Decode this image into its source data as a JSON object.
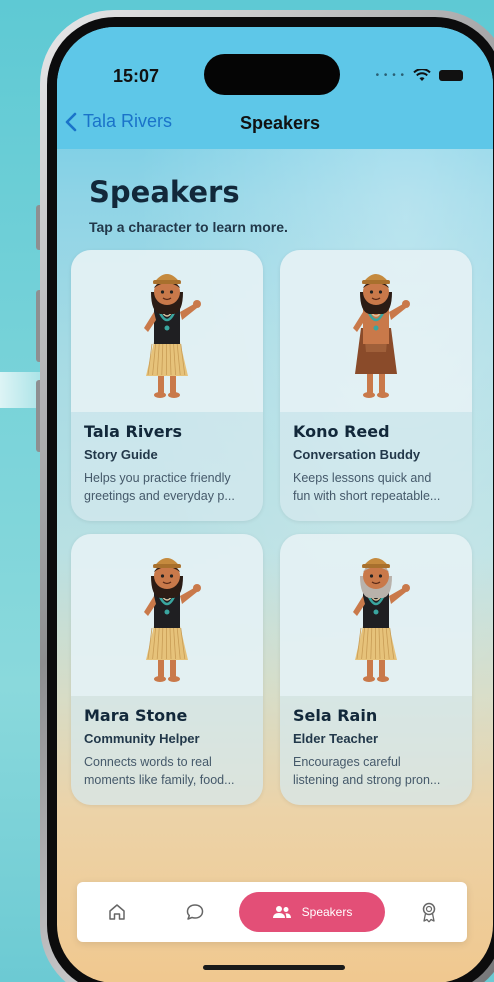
{
  "status": {
    "time": "15:07"
  },
  "nav": {
    "back_label": "Tala Rivers",
    "title": "Speakers"
  },
  "page": {
    "title": "Speakers",
    "subtitle": "Tap a character to learn more."
  },
  "speakers": [
    {
      "name": "Tala Rivers",
      "role": "Story Guide",
      "desc_line1": "Helps you practice friendly",
      "desc_line2": "greetings and everyday p...",
      "outfit": "grass",
      "hair": "black",
      "hat": "#c58a3e"
    },
    {
      "name": "Kono Reed",
      "role": "Conversation Buddy",
      "desc_line1": "Keeps lessons quick and",
      "desc_line2": "fun with short repeatable...",
      "outfit": "brown",
      "hair": "black",
      "hat": "#c58a3e"
    },
    {
      "name": "Mara Stone",
      "role": "Community Helper",
      "desc_line1": "Connects words to real",
      "desc_line2": "moments like family, food...",
      "outfit": "grass",
      "hair": "black",
      "hat": "#c58a3e"
    },
    {
      "name": "Sela Rain",
      "role": "Elder Teacher",
      "desc_line1": "Encourages careful",
      "desc_line2": "listening and strong pron...",
      "outfit": "grass",
      "hair": "gray",
      "hat": "#c58a3e"
    }
  ],
  "tabs": {
    "home_icon": "home-icon",
    "chat_icon": "chat-bubble-icon",
    "speakers_label": "Speakers",
    "speakers_icon": "people-icon",
    "awards_icon": "award-ribbon-icon",
    "active_color": "#e34f77"
  }
}
